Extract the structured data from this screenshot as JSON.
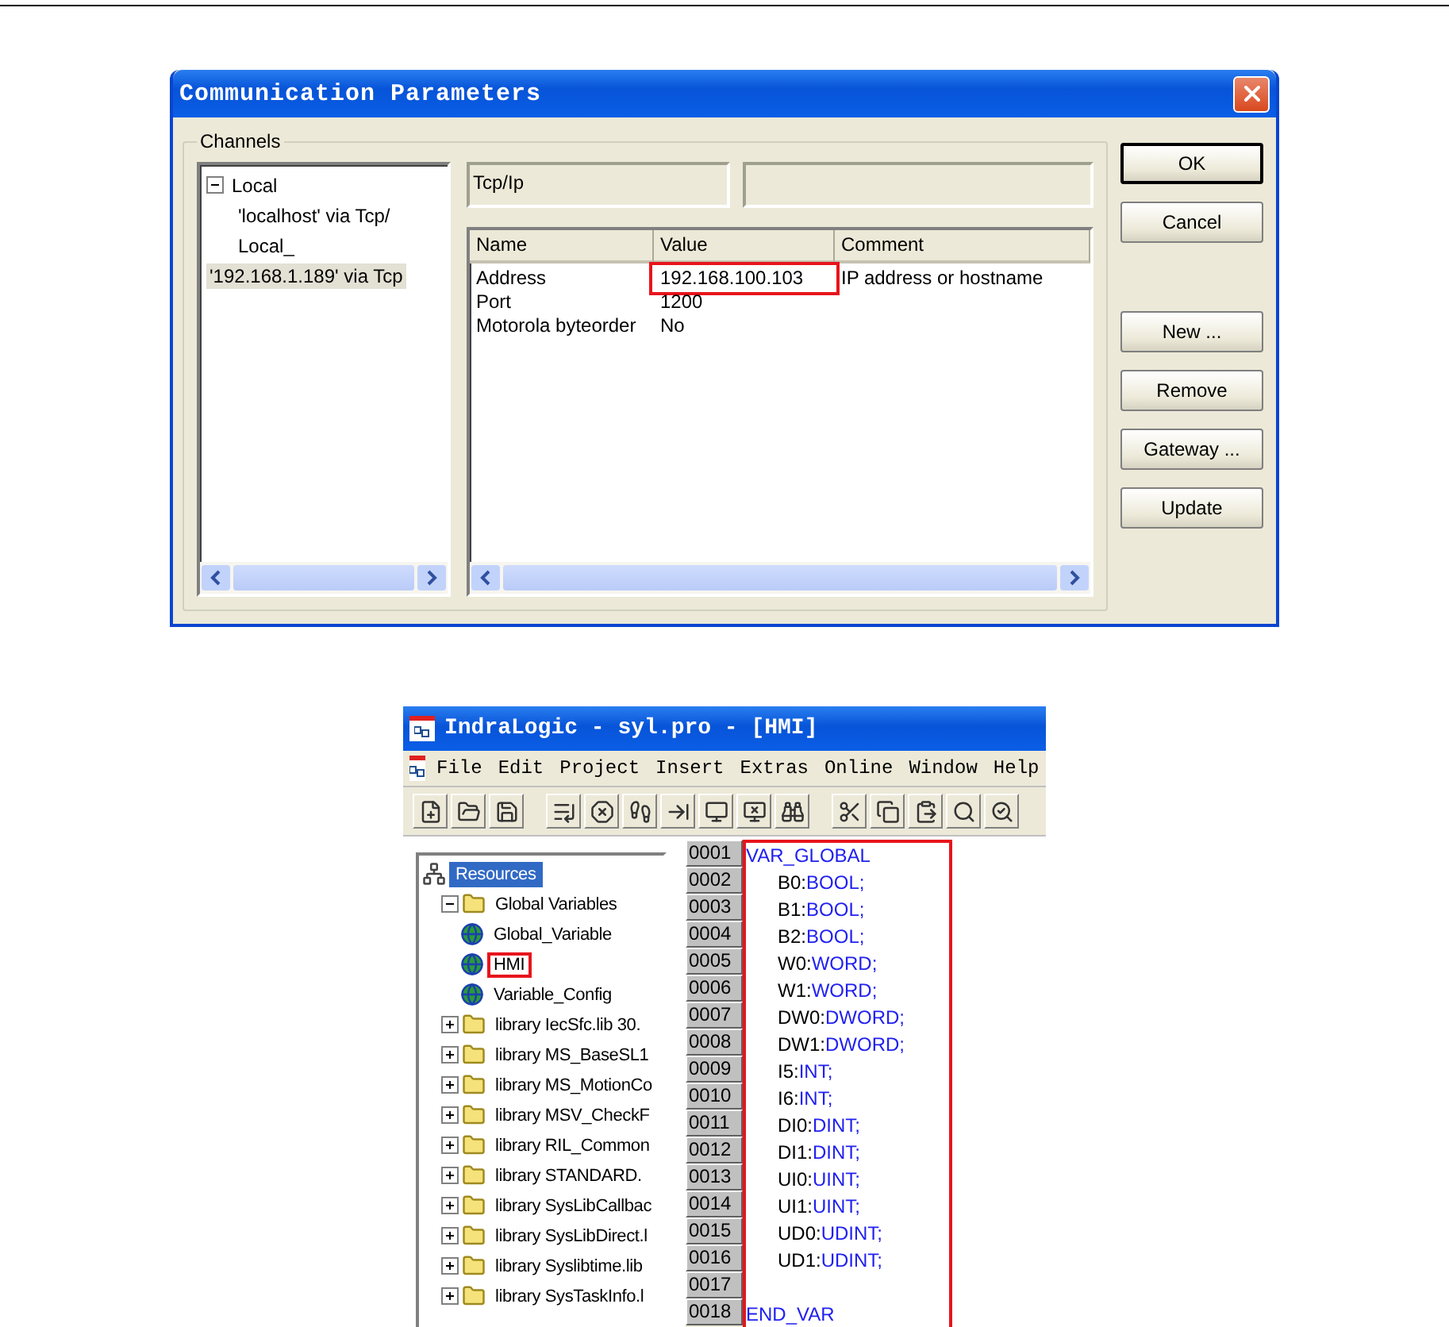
{
  "dialog": {
    "title": "Communication Parameters",
    "channels_label": "Channels",
    "channels": [
      {
        "label": "Local",
        "expanded": true,
        "selected": false,
        "children": [
          {
            "label": "'localhost' via Tcp/",
            "selected": false
          },
          {
            "label": "Local_",
            "selected": false
          }
        ]
      },
      {
        "label": "'192.168.1.189' via Tcp",
        "selected": true
      }
    ],
    "protocol": "Tcp/Ip",
    "columns": [
      "Name",
      "Value",
      "Comment"
    ],
    "rows": [
      {
        "name": "Address",
        "value": "192.168.100.103",
        "comment": "IP address or hostname",
        "highlighted": true
      },
      {
        "name": "Port",
        "value": "1200",
        "highlighted": false
      },
      {
        "name": "Motorola byteorder",
        "value": "No",
        "highlighted": false
      }
    ],
    "buttons": [
      {
        "label": "OK",
        "default": true
      },
      {
        "label": "Cancel",
        "default": false
      },
      {
        "label": "New ...",
        "default": false
      },
      {
        "label": "Remove",
        "default": false
      },
      {
        "label": "Gateway ...",
        "default": false
      },
      {
        "label": "Update",
        "default": false
      }
    ]
  },
  "ide": {
    "title": "IndraLogic - syl.pro - [HMI]",
    "menu": [
      "File",
      "Edit",
      "Project",
      "Insert",
      "Extras",
      "Online",
      "Window",
      "Help"
    ],
    "tree": [
      {
        "label": "Resources",
        "kind": "resources",
        "selected": true,
        "children": [
          {
            "label": "Global Variables",
            "kind": "folder",
            "expanded": true,
            "selected": false,
            "children": [
              {
                "label": "Global_Variable",
                "kind": "globe",
                "selected": false,
                "highlighted": false
              },
              {
                "label": "HMI",
                "kind": "globe",
                "selected": false,
                "highlighted": true
              },
              {
                "label": "Variable_Config",
                "kind": "globe",
                "selected": false,
                "highlighted": false
              }
            ]
          },
          {
            "label": "library IecSfc.lib 30.",
            "kind": "folder",
            "expanded": false,
            "selected": false
          },
          {
            "label": "library MS_BaseSL1",
            "kind": "folder",
            "expanded": false,
            "selected": false
          },
          {
            "label": "library MS_MotionCo",
            "kind": "folder",
            "expanded": false,
            "selected": false
          },
          {
            "label": "library MSV_CheckF",
            "kind": "folder",
            "expanded": false,
            "selected": false
          },
          {
            "label": "library RIL_Common",
            "kind": "folder",
            "expanded": false,
            "selected": false
          },
          {
            "label": "library STANDARD.",
            "kind": "folder",
            "expanded": false,
            "selected": false
          },
          {
            "label": "library SysLibCallbac",
            "kind": "folder",
            "expanded": false,
            "selected": false
          },
          {
            "label": "library SysLibDirect.l",
            "kind": "folder",
            "expanded": false,
            "selected": false
          },
          {
            "label": "library Syslibtime.lib",
            "kind": "folder",
            "expanded": false,
            "selected": false
          },
          {
            "label": "library SysTaskInfo.l",
            "kind": "folder",
            "expanded": false,
            "selected": false
          }
        ]
      }
    ],
    "code_highlighted": true,
    "code": [
      {
        "number": "0001",
        "kind": "keyword",
        "text": "VAR_GLOBAL"
      },
      {
        "number": "0002",
        "kind": "decl",
        "name": "B0:",
        "type": "BOOL;"
      },
      {
        "number": "0003",
        "kind": "decl",
        "name": "B1:",
        "type": "BOOL;"
      },
      {
        "number": "0004",
        "kind": "decl",
        "name": "B2:",
        "type": "BOOL;"
      },
      {
        "number": "0005",
        "kind": "decl",
        "name": "W0:",
        "type": "WORD;"
      },
      {
        "number": "0006",
        "kind": "decl",
        "name": "W1:",
        "type": "WORD;"
      },
      {
        "number": "0007",
        "kind": "decl",
        "name": "DW0:",
        "type": "DWORD;"
      },
      {
        "number": "0008",
        "kind": "decl",
        "name": "DW1:",
        "type": "DWORD;"
      },
      {
        "number": "0009",
        "kind": "decl",
        "name": "I5:",
        "type": "INT;"
      },
      {
        "number": "0010",
        "kind": "decl",
        "name": "I6:",
        "type": "INT;"
      },
      {
        "number": "0011",
        "kind": "decl",
        "name": "DI0:",
        "type": "DINT;"
      },
      {
        "number": "0012",
        "kind": "decl",
        "name": "DI1:",
        "type": "DINT;"
      },
      {
        "number": "0013",
        "kind": "decl",
        "name": "UI0:",
        "type": "UINT;"
      },
      {
        "number": "0014",
        "kind": "decl",
        "name": "UI1:",
        "type": "UINT;"
      },
      {
        "number": "0015",
        "kind": "decl",
        "name": "UD0:",
        "type": "UDINT;"
      },
      {
        "number": "0016",
        "kind": "decl",
        "name": "UD1:",
        "type": "UDINT;"
      },
      {
        "number": "0017",
        "kind": "blank"
      },
      {
        "number": "0018",
        "kind": "keyword",
        "text": "END_VAR"
      }
    ]
  }
}
